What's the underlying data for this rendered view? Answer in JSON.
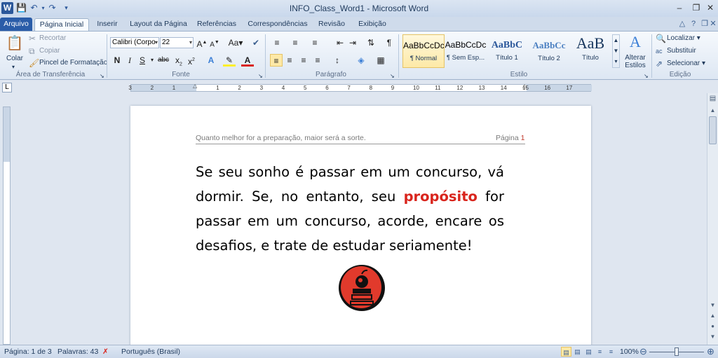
{
  "window": {
    "title": "INFO_Class_Word1 - Microsoft Word",
    "app_icon": "W",
    "quick_access": [
      "save-icon",
      "undo-icon",
      "redo-icon",
      "customize-icon"
    ]
  },
  "tabs": [
    {
      "label": "Arquivo",
      "kind": "file"
    },
    {
      "label": "Página Inicial",
      "kind": "active"
    },
    {
      "label": "Inserir"
    },
    {
      "label": "Layout da Página"
    },
    {
      "label": "Referências"
    },
    {
      "label": "Correspondências"
    },
    {
      "label": "Revisão"
    },
    {
      "label": "Exibição"
    }
  ],
  "ribbon": {
    "clipboard": {
      "paste": "Colar",
      "cut": "Recortar",
      "copy": "Copiar",
      "format_painter": "Pincel de Formatação",
      "group": "Área de Transferência"
    },
    "font": {
      "name": "Calibri (Corpo",
      "size": "22",
      "group": "Fonte"
    },
    "paragraph": {
      "group": "Parágrafo"
    },
    "styles": {
      "items": [
        {
          "preview": "AaBbCcDc",
          "name": "¶ Normal"
        },
        {
          "preview": "AaBbCcDc",
          "name": "¶ Sem Esp..."
        },
        {
          "preview": "AaBbC",
          "name": "Título 1"
        },
        {
          "preview": "AaBbCc",
          "name": "Título 2"
        },
        {
          "preview": "AaB",
          "name": "Título"
        }
      ],
      "change": "Alterar Estilos",
      "group": "Estilo"
    },
    "editing": {
      "find": "Localizar",
      "replace": "Substituir",
      "select": "Selecionar",
      "group": "Edição"
    }
  },
  "ruler": {
    "labels": [
      "3",
      "2",
      "1",
      "1",
      "2",
      "3",
      "4",
      "5",
      "6",
      "7",
      "8",
      "9",
      "10",
      "11",
      "12",
      "13",
      "14",
      "15",
      "16",
      "17"
    ]
  },
  "document": {
    "header_text": "Quanto melhor for a preparação, maior será a sorte.",
    "header_page_label": "Página",
    "header_page_number": "1",
    "body_before": "Se seu sonho é passar em um concurso, vá dormir. Se, no entanto, seu ",
    "body_highlight": "propósito",
    "body_after": " for passar em um concurso, acorde, encare os desafios, e trate de estudar seriamente!",
    "highlight_color": "#d9251d"
  },
  "status": {
    "page": "Página: 1 de 3",
    "words": "Palavras: 43",
    "language": "Português (Brasil)",
    "zoom": "100%"
  }
}
